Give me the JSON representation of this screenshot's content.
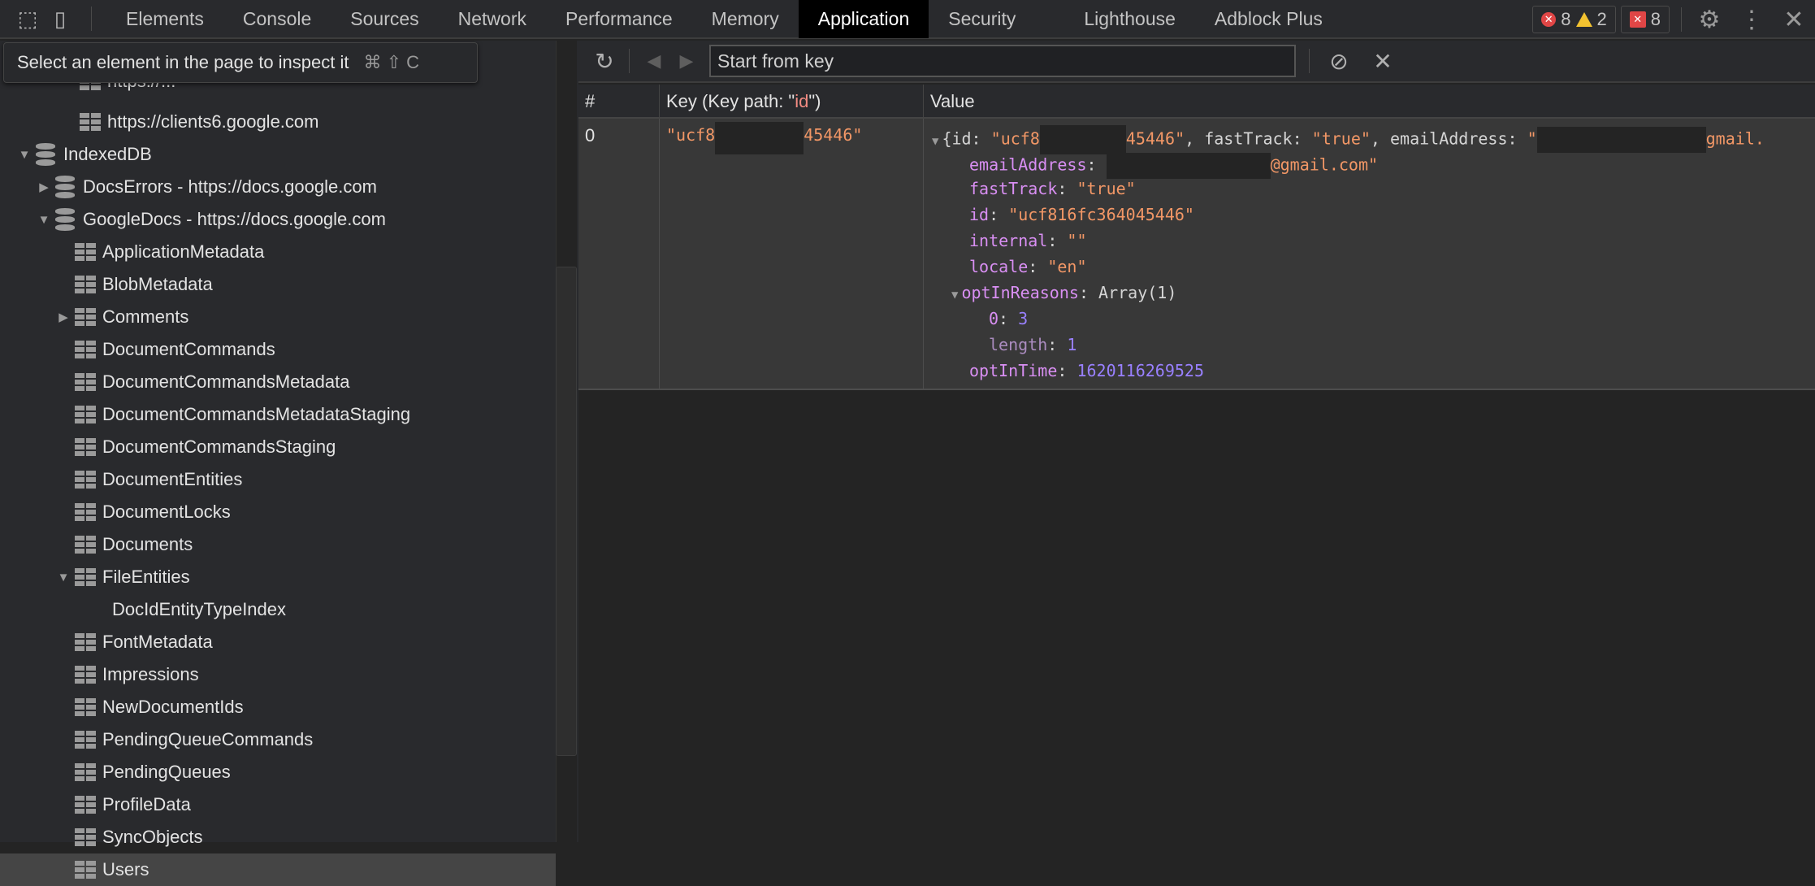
{
  "tabs": [
    "Elements",
    "Console",
    "Sources",
    "Network",
    "Performance",
    "Memory",
    "Application",
    "Security",
    "Lighthouse",
    "Adblock Plus"
  ],
  "active_tab": "Application",
  "counts": {
    "errors": "8",
    "warnings": "2",
    "issues": "8"
  },
  "tooltip": {
    "text": "Select an element in the page to inspect it",
    "shortcut": "⌘ ⇧ C"
  },
  "sidebar": {
    "partial_top": "https://...",
    "partial_item": "https://clients6.google.com",
    "indexeddb": "IndexedDB",
    "databases": [
      "DocsErrors - https://docs.google.com",
      "GoogleDocs - https://docs.google.com"
    ],
    "stores": [
      "ApplicationMetadata",
      "BlobMetadata",
      "Comments",
      "DocumentCommands",
      "DocumentCommandsMetadata",
      "DocumentCommandsMetadataStaging",
      "DocumentCommandsStaging",
      "DocumentEntities",
      "DocumentLocks",
      "Documents",
      "FileEntities",
      "DocIdEntityTypeIndex",
      "FontMetadata",
      "Impressions",
      "NewDocumentIds",
      "PendingQueueCommands",
      "PendingQueues",
      "ProfileData",
      "SyncObjects",
      "Users"
    ],
    "selected": "Users"
  },
  "toolbar": {
    "placeholder": "Start from key"
  },
  "table": {
    "headers": {
      "num": "#",
      "key_prefix": "Key (Key path: \"",
      "key_path": "id",
      "key_suffix": "\")",
      "value": "Value"
    },
    "row": {
      "index": "0",
      "key_start": "\"ucf8",
      "key_end": "45446\"",
      "summary": {
        "open": "{id: ",
        "id_start": "\"ucf8",
        "id_end": "45446\"",
        "mid": ", fastTrack: ",
        "fasttrack": "\"true\"",
        "mid2": ", emailAddress: ",
        "email_start": "\"",
        "email_end": "gmail."
      },
      "props": {
        "emailAddress_key": "emailAddress",
        "emailAddress_end": "@gmail.com\"",
        "fastTrack_key": "fastTrack",
        "fastTrack_val": "\"true\"",
        "id_key": "id",
        "id_val": "\"ucf816fc364045446\"",
        "internal_key": "internal",
        "internal_val": "\"\"",
        "locale_key": "locale",
        "locale_val": "\"en\"",
        "optInReasons_key": "optInReasons",
        "optInReasons_val": "Array(1)",
        "idx0_key": "0",
        "idx0_val": "3",
        "length_key": "length",
        "length_val": "1",
        "optInTime_key": "optInTime",
        "optInTime_val": "1620116269525"
      }
    }
  }
}
